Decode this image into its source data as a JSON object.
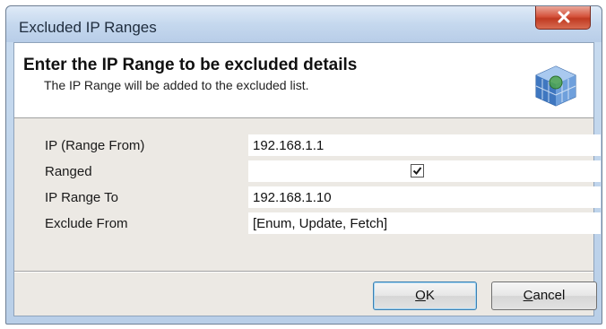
{
  "window": {
    "title": "Excluded IP Ranges"
  },
  "header": {
    "title": "Enter the IP Range to be excluded details",
    "subtitle": "The IP Range will be added to the excluded list.",
    "icon": "network-cube-icon"
  },
  "fields": [
    {
      "label": "IP (Range From)",
      "value": "192.168.1.1"
    },
    {
      "label": "Ranged",
      "checked": true
    },
    {
      "label": "IP Range To",
      "value": "192.168.1.10"
    },
    {
      "label": "Exclude From",
      "value": "[Enum, Update, Fetch]"
    }
  ],
  "buttons": {
    "ok_label": "OK",
    "cancel_label": "Cancel"
  },
  "colors": {
    "close_button": "#d6543d",
    "client_background": "#ece9e4",
    "title_bar": "#c5d8ee"
  }
}
